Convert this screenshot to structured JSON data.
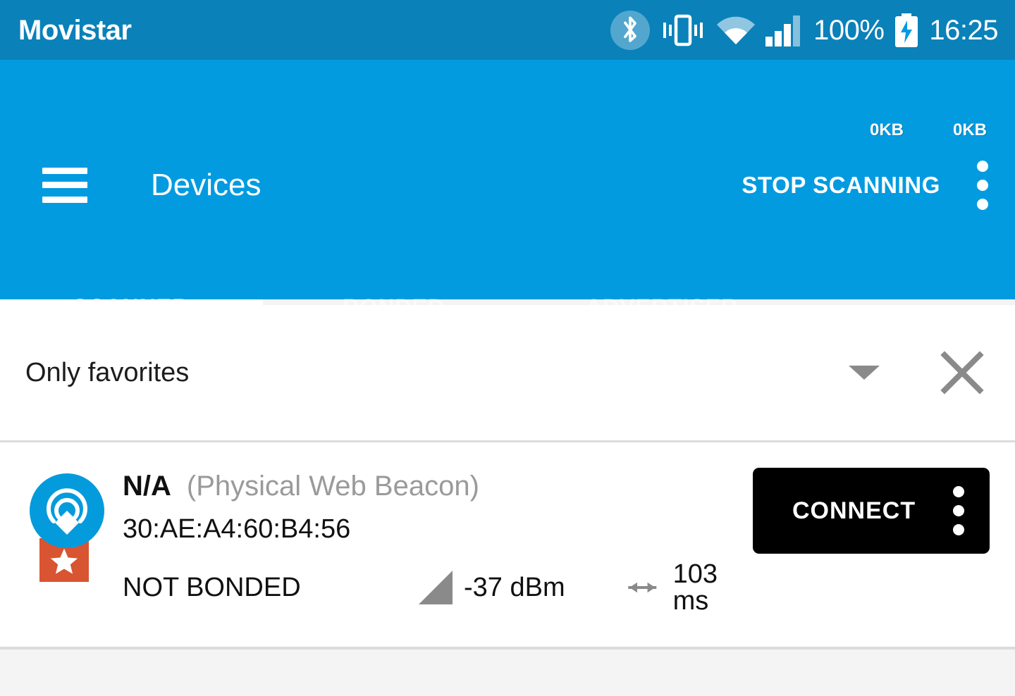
{
  "status_bar": {
    "carrier": "Movistar",
    "battery_percent": "100%",
    "clock": "16:25",
    "icons": {
      "bluetooth": "bluetooth-icon",
      "vibrate": "vibrate-icon",
      "wifi": "wifi-icon",
      "signal": "cellular-signal-icon",
      "battery": "battery-charging-icon"
    },
    "background_color": "#0a81b9"
  },
  "app_bar": {
    "title": "Devices",
    "action_label": "STOP SCANNING",
    "menu_icon": "overflow-menu-icon",
    "nav_icon": "hamburger-menu-icon",
    "traffic": {
      "upload": "0KB",
      "download": "0KB"
    },
    "background_color": "#039be0"
  },
  "tabs": {
    "items": [
      {
        "label": "SCANNER",
        "active": true
      },
      {
        "label": "BONDED",
        "active": false
      },
      {
        "label": "ADVERTISER",
        "active": false
      }
    ],
    "indicator_color": "#ffffff"
  },
  "filter": {
    "label": "Only favorites",
    "dropdown_icon": "chevron-down-icon",
    "clear_icon": "close-icon"
  },
  "devices": [
    {
      "name": "N/A",
      "type": "(Physical Web Beacon)",
      "address": "30:AE:A4:60:B4:56",
      "bond_state": "NOT BONDED",
      "rssi": "-37 dBm",
      "interval": "103 ms",
      "favorite": true,
      "icon": "beacon-icon",
      "favorite_icon": "star-ribbon-icon",
      "rssi_icon": "signal-strength-icon",
      "interval_icon": "left-right-arrow-icon",
      "connect_label": "CONNECT",
      "connect_menu_icon": "overflow-menu-icon",
      "connect_bg_color": "#000000",
      "avatar_color": "#049bdc",
      "favorite_color": "#d95430"
    }
  ]
}
